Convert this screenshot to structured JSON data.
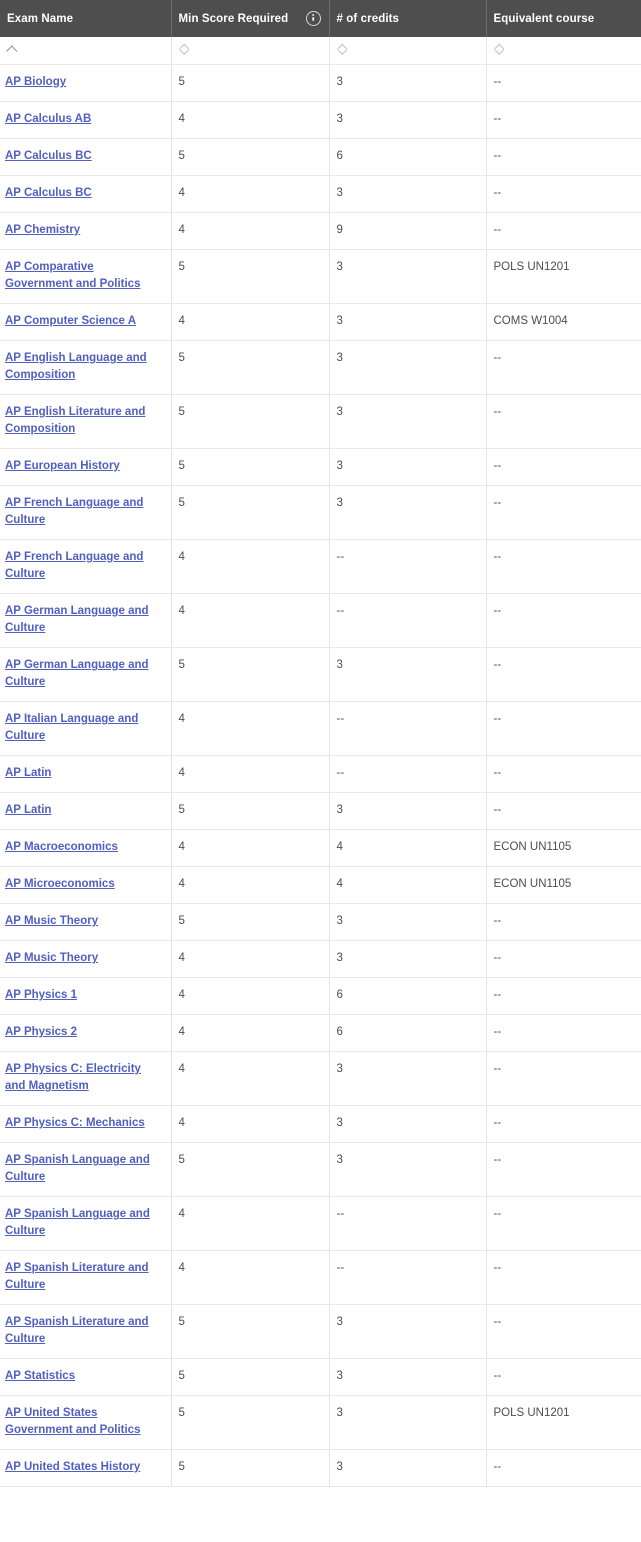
{
  "table": {
    "columns": [
      {
        "key": "exam",
        "label": "Exam Name",
        "sort_icon": "sort-ascending-icon",
        "has_info_icon": false
      },
      {
        "key": "score",
        "label": "Min Score Required",
        "sort_icon": "sort-none-icon",
        "has_info_icon": true,
        "info_icon": "info-circle-icon"
      },
      {
        "key": "cred",
        "label": "# of credits",
        "sort_icon": "sort-none-icon",
        "has_info_icon": false
      },
      {
        "key": "equiv",
        "label": "Equivalent course",
        "sort_icon": "sort-none-icon",
        "has_info_icon": false
      }
    ],
    "rows": [
      {
        "exam": "AP Biology",
        "score": "5",
        "cred": "3",
        "equiv": "--"
      },
      {
        "exam": "AP Calculus AB",
        "score": "4",
        "cred": "3",
        "equiv": "--"
      },
      {
        "exam": "AP Calculus BC",
        "score": "5",
        "cred": "6",
        "equiv": "--"
      },
      {
        "exam": "AP Calculus BC",
        "score": "4",
        "cred": "3",
        "equiv": "--"
      },
      {
        "exam": "AP Chemistry",
        "score": "4",
        "cred": "9",
        "equiv": "--"
      },
      {
        "exam": "AP Comparative Government and Politics",
        "score": "5",
        "cred": "3",
        "equiv": "POLS UN1201"
      },
      {
        "exam": "AP Computer Science A",
        "score": "4",
        "cred": "3",
        "equiv": "COMS W1004"
      },
      {
        "exam": "AP English Language and Composition",
        "score": "5",
        "cred": "3",
        "equiv": "--"
      },
      {
        "exam": "AP English Literature and Composition",
        "score": "5",
        "cred": "3",
        "equiv": "--"
      },
      {
        "exam": "AP European History",
        "score": "5",
        "cred": "3",
        "equiv": "--"
      },
      {
        "exam": "AP French Language and Culture",
        "score": "5",
        "cred": "3",
        "equiv": "--"
      },
      {
        "exam": "AP French Language and Culture",
        "score": "4",
        "cred": "--",
        "equiv": "--"
      },
      {
        "exam": "AP German Language and Culture",
        "score": "4",
        "cred": "--",
        "equiv": "--"
      },
      {
        "exam": "AP German Language and Culture",
        "score": "5",
        "cred": "3",
        "equiv": "--"
      },
      {
        "exam": "AP Italian Language and Culture",
        "score": "4",
        "cred": "--",
        "equiv": "--"
      },
      {
        "exam": "AP Latin",
        "score": "4",
        "cred": "--",
        "equiv": "--"
      },
      {
        "exam": "AP Latin",
        "score": "5",
        "cred": "3",
        "equiv": "--"
      },
      {
        "exam": "AP Macroeconomics",
        "score": "4",
        "cred": "4",
        "equiv": "ECON UN1105"
      },
      {
        "exam": "AP Microeconomics",
        "score": "4",
        "cred": "4",
        "equiv": "ECON UN1105"
      },
      {
        "exam": "AP Music Theory",
        "score": "5",
        "cred": "3",
        "equiv": "--"
      },
      {
        "exam": "AP Music Theory",
        "score": "4",
        "cred": "3",
        "equiv": "--"
      },
      {
        "exam": "AP Physics 1",
        "score": "4",
        "cred": "6",
        "equiv": "--"
      },
      {
        "exam": "AP Physics 2",
        "score": "4",
        "cred": "6",
        "equiv": "--"
      },
      {
        "exam": "AP Physics C: Electricity and Magnetism",
        "score": "4",
        "cred": "3",
        "equiv": "--"
      },
      {
        "exam": "AP Physics C: Mechanics",
        "score": "4",
        "cred": "3",
        "equiv": "--"
      },
      {
        "exam": "AP Spanish Language and Culture",
        "score": "5",
        "cred": "3",
        "equiv": "--"
      },
      {
        "exam": "AP Spanish Language and Culture",
        "score": "4",
        "cred": "--",
        "equiv": "--"
      },
      {
        "exam": "AP Spanish Literature and Culture",
        "score": "4",
        "cred": "--",
        "equiv": "--"
      },
      {
        "exam": "AP Spanish Literature and Culture",
        "score": "5",
        "cred": "3",
        "equiv": "--"
      },
      {
        "exam": "AP Statistics",
        "score": "5",
        "cred": "3",
        "equiv": "--"
      },
      {
        "exam": "AP United States Government and Politics",
        "score": "5",
        "cred": "3",
        "equiv": "POLS UN1201"
      },
      {
        "exam": "AP United States History",
        "score": "5",
        "cred": "3",
        "equiv": "--"
      }
    ]
  },
  "colors": {
    "header_background": "#4e4e4e",
    "header_text": "#ffffff",
    "link": "#5160c0",
    "cell_text": "#4a4a4a",
    "row_border": "#e9e9e9",
    "column_border": "#e4e4e4",
    "page_background": "#ffffff"
  }
}
